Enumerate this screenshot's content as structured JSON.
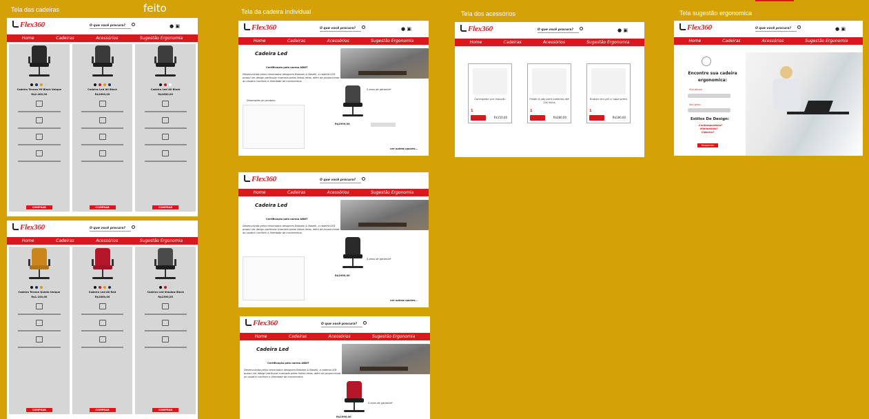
{
  "labels": {
    "screen1": "Tela das cadeiras",
    "feito": "feito",
    "screen2": "Tela da cadeira individual",
    "screen3": "Tela dos acessórios",
    "screen4": "Tela sugestão ergonomica"
  },
  "brand": {
    "name": "Flex360",
    "accent": "#d8181c",
    "background": "#d4a106"
  },
  "header": {
    "search_placeholder": "O que você procura?",
    "user_icon": "user-icon",
    "cart_icon": "cart-icon"
  },
  "nav": [
    "Home",
    "Cadeiras",
    "Acessórios",
    "Sugestão Ergonomia"
  ],
  "catalog_row1": [
    {
      "name": "Cadeira Tecnos Mf Black Unique",
      "price": "R$2.400,00"
    },
    {
      "name": "Cadeira Led All Black",
      "price": "R$1600,00"
    },
    {
      "name": "Cadeira Led All Black",
      "price": "R$1600,00"
    }
  ],
  "catalog_row2": [
    {
      "name": "Cadeira Tecnos Quinta Unique",
      "price": "R$1.100,00"
    },
    {
      "name": "Cadeira Led All Red",
      "price": "R$1600,00"
    },
    {
      "name": "Cadeira Led Shadow Black",
      "price": "R$1590,00"
    }
  ],
  "buy_label": "COMPRAR",
  "detail": {
    "title": "Cadeira Led",
    "cert": "Certificação pela norma ABNT",
    "desc": "Desenvolvida pelos renomados designers Balsiani & Naselli, a cadeira LED possui um design particular marcado pelas linhas retas, além de proporcionar ao usuário conforto e liberdade de movimentos.",
    "dims_label": "Dimensões do produto:",
    "warranty": "5 anos de garantia*",
    "prices": [
      "R$1999,00",
      "R$1990,00",
      "R$1990,00"
    ],
    "more": "ver outras opções..."
  },
  "accessories": [
    {
      "name": "Carregador por indução",
      "price": "R$150,00",
      "qty": "1"
    },
    {
      "name": "Pistão à gás para cadeiras até 150 Kilos",
      "price": "R$280,00",
      "qty": "1"
    },
    {
      "name": "Rodízio em gel c/ sapa preto",
      "price": "R$180,00",
      "qty": "1"
    }
  ],
  "ergo": {
    "title": "Encontre sua cadeira ergonomica:",
    "field1": "Sua altura:",
    "field2": "Seu peso:",
    "styles_title": "Estilos De Design:",
    "styles": [
      "Contemporâneo?",
      "Minimalista?",
      "Clássico?"
    ],
    "button": "Responder"
  }
}
